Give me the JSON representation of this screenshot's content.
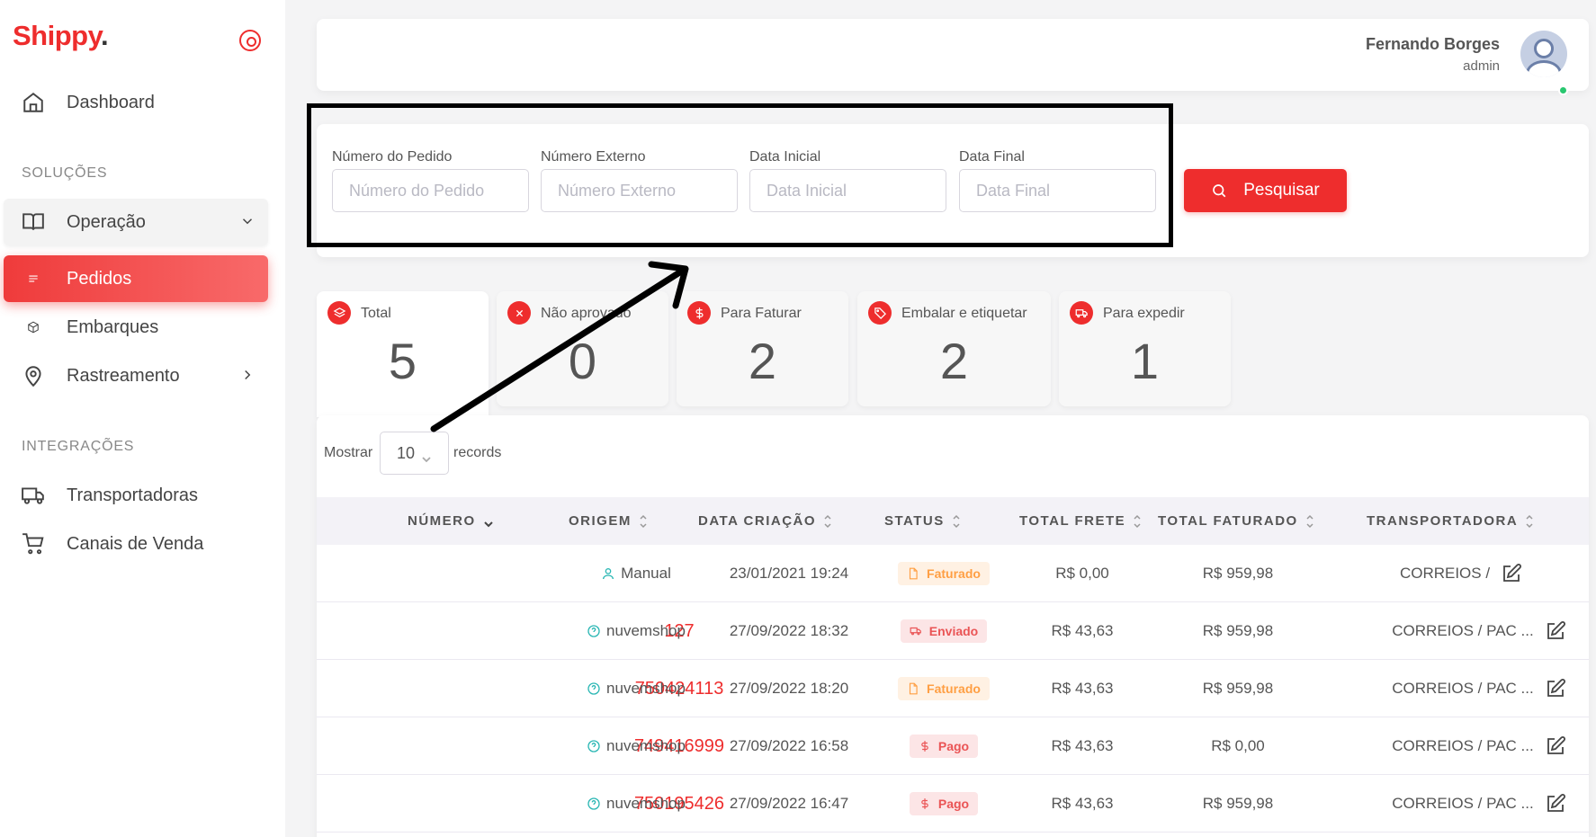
{
  "brand": {
    "name": "Shippy",
    "dot": "."
  },
  "sidebar": {
    "dashboard": "Dashboard",
    "section_solucoes": "SOLUÇÕES",
    "operacao": "Operação",
    "pedidos": "Pedidos",
    "embarques": "Embarques",
    "rastreamento": "Rastreamento",
    "section_integracoes": "INTEGRAÇÕES",
    "transportadoras": "Transportadoras",
    "canais": "Canais de Venda"
  },
  "user": {
    "name": "Fernando Borges",
    "role": "admin"
  },
  "filters": {
    "numero_pedido": {
      "label": "Número do Pedido",
      "placeholder": "Número do Pedido",
      "value": ""
    },
    "numero_externo": {
      "label": "Número Externo",
      "placeholder": "Número Externo",
      "value": ""
    },
    "data_inicial": {
      "label": "Data Inicial",
      "placeholder": "Data Inicial",
      "value": ""
    },
    "data_final": {
      "label": "Data Final",
      "placeholder": "Data Final",
      "value": ""
    },
    "search_label": "Pesquisar"
  },
  "stats": [
    {
      "label": "Total",
      "value": "5",
      "icon": "layers-icon"
    },
    {
      "label": "Não aprovado",
      "value": "0",
      "icon": "x-circle-icon"
    },
    {
      "label": "Para Faturar",
      "value": "2",
      "icon": "dollar-icon"
    },
    {
      "label": "Embalar e etiquetar",
      "value": "2",
      "icon": "tag-icon"
    },
    {
      "label": "Para expedir",
      "value": "1",
      "icon": "truck-icon"
    }
  ],
  "table": {
    "show_label": "Mostrar",
    "page_size": "10",
    "records_label": "records",
    "headers": {
      "numero": "NÚMERO",
      "origem": "ORIGEM",
      "data": "DATA CRIAÇÃO",
      "status": "STATUS",
      "frete": "TOTAL FRETE",
      "faturado": "TOTAL FATURADO",
      "transportadora": "TRANSPORTADORA"
    },
    "rows": [
      {
        "numero": "",
        "origem": "Manual",
        "origem_icon": "user-icon",
        "data": "23/01/2021 19:24",
        "status": "Faturado",
        "status_type": "faturado",
        "frete": "R$ 0,00",
        "faturado": "R$ 959,98",
        "transportadora": "CORREIOS /"
      },
      {
        "numero": "127",
        "origem": "nuvemshop",
        "origem_icon": "help-circle-icon",
        "data": "27/09/2022 18:32",
        "status": "Enviado",
        "status_type": "enviado",
        "frete": "R$ 43,63",
        "faturado": "R$ 959,98",
        "transportadora": "CORREIOS / PAC ..."
      },
      {
        "numero": "750424113",
        "origem": "nuvemshop",
        "origem_icon": "help-circle-icon",
        "data": "27/09/2022 18:20",
        "status": "Faturado",
        "status_type": "faturado",
        "frete": "R$ 43,63",
        "faturado": "R$ 959,98",
        "transportadora": "CORREIOS / PAC ..."
      },
      {
        "numero": "749416999",
        "origem": "nuvemshop",
        "origem_icon": "help-circle-icon",
        "data": "27/09/2022 16:58",
        "status": "Pago",
        "status_type": "pago",
        "frete": "R$ 43,63",
        "faturado": "R$ 0,00",
        "transportadora": "CORREIOS / PAC ..."
      },
      {
        "numero": "750195426",
        "origem": "nuvemshop",
        "origem_icon": "help-circle-icon",
        "data": "27/09/2022 16:47",
        "status": "Pago",
        "status_type": "pago",
        "frete": "R$ 43,63",
        "faturado": "R$ 959,98",
        "transportadora": "CORREIOS / PAC ..."
      }
    ]
  },
  "colors": {
    "accent": "#ee2d2d",
    "faturado": "#ff9f43",
    "danger": "#ea5455",
    "online": "#28c76f",
    "origem": "#2bb7b4"
  }
}
